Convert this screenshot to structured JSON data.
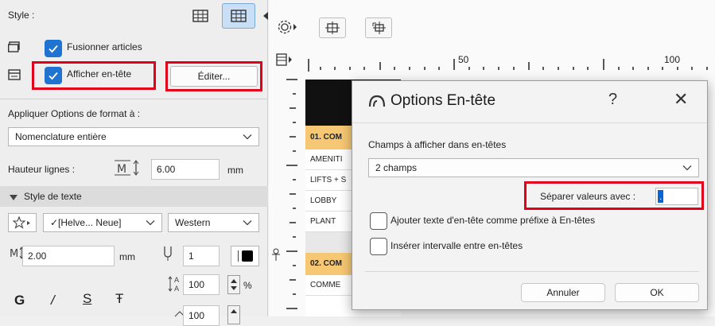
{
  "left_panel": {
    "style_label": "Style :",
    "merge_items_label": "Fusionner articles",
    "show_header_label": "Afficher en-tête",
    "edit_button": "Éditer...",
    "apply_format_label": "Appliquer Options de format à :",
    "apply_format_value": "Nomenclature entière",
    "row_height_label": "Hauteur lignes :",
    "row_height_value": "6.00",
    "row_height_unit": "mm",
    "text_style_section": "Style de texte",
    "font_value": "✓[Helve... Neue]",
    "charset_value": "Western",
    "text_size_value": "2.00",
    "text_size_unit": "mm",
    "pen_value": "1",
    "ratio1_value": "100",
    "ratio1_unit": "%",
    "ratio2_value": "100",
    "bold_glyph": "G",
    "italic_glyph": "/",
    "underline_glyph": "S",
    "strike_glyph": "Ŧ"
  },
  "ruler": {
    "label_50": "50",
    "label_100": "100"
  },
  "table_preview": {
    "rows": [
      "01. COM",
      "AMENITI",
      "LIFTS + S",
      "LOBBY",
      "PLANT",
      "02. COM",
      "COMME"
    ],
    "accent_color": "#f7c873"
  },
  "dialog": {
    "title": "Options En-tête",
    "help": "?",
    "close": "✕",
    "fields_label": "Champs à afficher dans en-têtes",
    "fields_value": "2 champs",
    "separator_label": "Séparer valeurs avec :",
    "separator_value": ".",
    "prefix_checkbox": "Ajouter texte d'en-tête comme préfixe à En-têtes",
    "interval_checkbox": "Insérer intervalle entre en-têtes",
    "cancel_button": "Annuler",
    "ok_button": "OK"
  },
  "colors": {
    "checkbox_blue": "#1f73d1",
    "highlight_red": "#e3001b",
    "selection_blue": "#0a64d8"
  }
}
